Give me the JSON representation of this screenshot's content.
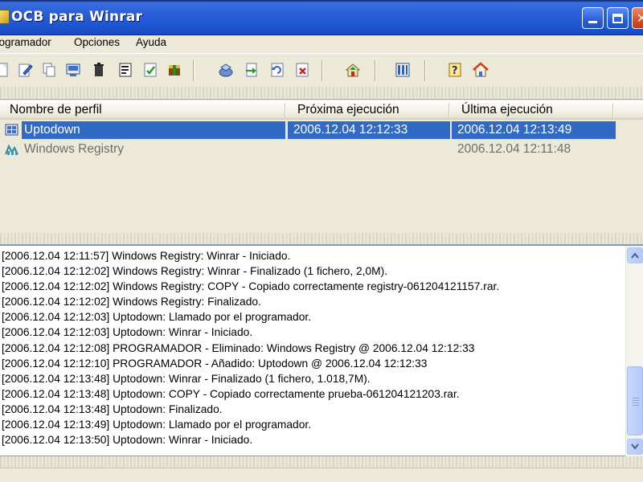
{
  "window": {
    "title": "OCB para Winrar",
    "controls": {
      "minimize": "minimize-icon",
      "maximize": "maximize-icon",
      "close": "close-icon"
    }
  },
  "menu": {
    "items": [
      {
        "label": "rogramador"
      },
      {
        "label": "Opciones"
      },
      {
        "label": "Ayuda"
      }
    ]
  },
  "toolbar": {
    "icons": [
      "new-profile-icon",
      "edit-profile-icon",
      "copy-profile-icon",
      "properties-icon",
      "delete-icon",
      "script-icon",
      "check-icon",
      "run-icon",
      "backup-icon",
      "restore-icon",
      "refresh-icon",
      "cancel-icon",
      "home-export-icon",
      "columns-icon",
      "help-icon",
      "home-icon"
    ]
  },
  "profiles": {
    "columns": {
      "name": "Nombre de perfil",
      "next_run": "Próxima ejecución",
      "last_run": "Última ejecución"
    },
    "rows": [
      {
        "name": "Uptodown",
        "next_run": "2006.12.04 12:12:33",
        "last_run": "2006.12.04 12:13:49",
        "selected": true,
        "icon": "profile-icon"
      },
      {
        "name": "Windows Registry",
        "next_run": "",
        "last_run": "2006.12.04 12:11:48",
        "selected": false,
        "icon": "registry-icon"
      }
    ]
  },
  "log": {
    "lines": [
      "[2006.12.04 12:11:57] Windows Registry: Winrar - Iniciado.",
      "[2006.12.04 12:12:02] Windows Registry: Winrar - Finalizado (1 fichero, 2,0M).",
      "[2006.12.04 12:12:02] Windows Registry: COPY - Copiado correctamente registry-061204121157.rar.",
      "[2006.12.04 12:12:02] Windows Registry: Finalizado.",
      "[2006.12.04 12:12:03] Uptodown: Llamado por el programador.",
      "[2006.12.04 12:12:03] Uptodown: Winrar - Iniciado.",
      "[2006.12.04 12:12:08] PROGRAMADOR - Eliminado: Windows Registry @ 2006.12.04 12:12:33",
      "[2006.12.04 12:12:10] PROGRAMADOR - Añadido: Uptodown @ 2006.12.04 12:12:33",
      "[2006.12.04 12:13:48] Uptodown: Winrar - Finalizado (1 fichero, 1.018,7M).",
      "[2006.12.04 12:13:48] Uptodown: COPY - Copiado correctamente prueba-061204121203.rar.",
      "[2006.12.04 12:13:48] Uptodown: Finalizado.",
      "[2006.12.04 12:13:49] Uptodown: Llamado por el programador.",
      "[2006.12.04 12:13:50] Uptodown: Winrar - Iniciado."
    ]
  },
  "colors": {
    "titlebar": "#2a5fd8",
    "selection": "#316ac5",
    "window_bg": "#ece9d8"
  }
}
